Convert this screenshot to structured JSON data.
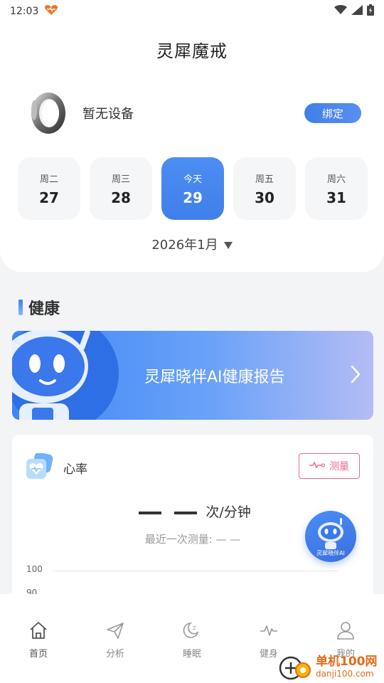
{
  "status_bar": {
    "time": "12:03"
  },
  "header": {
    "title": "灵犀魔戒"
  },
  "device": {
    "status": "暂无设备",
    "bind_label": "绑定"
  },
  "days": [
    {
      "name": "周二",
      "num": "27"
    },
    {
      "name": "周三",
      "num": "28"
    },
    {
      "name": "今天",
      "num": "29"
    },
    {
      "name": "周五",
      "num": "30"
    },
    {
      "name": "周六",
      "num": "31"
    }
  ],
  "month": "2026年1月",
  "health": {
    "section_title": "健康",
    "banner_text": "灵犀晓伴AI健康报告"
  },
  "heart_rate": {
    "title": "心率",
    "measure_label": "测量",
    "unit": "次/分钟",
    "last_label": "最近一次测量: — —",
    "ticks": [
      "100",
      "90"
    ]
  },
  "ai_fab_label": "灵犀晓伴AI",
  "tabs": [
    {
      "label": "首页"
    },
    {
      "label": "分析"
    },
    {
      "label": "睡眠"
    },
    {
      "label": "健身"
    },
    {
      "label": "我的"
    }
  ],
  "watermark": {
    "title": "单机100网",
    "url": "danji100.com"
  },
  "colors": {
    "accent": "#3f7fe9",
    "measure": "#e86a8e",
    "watermark": "#e56a1a"
  }
}
